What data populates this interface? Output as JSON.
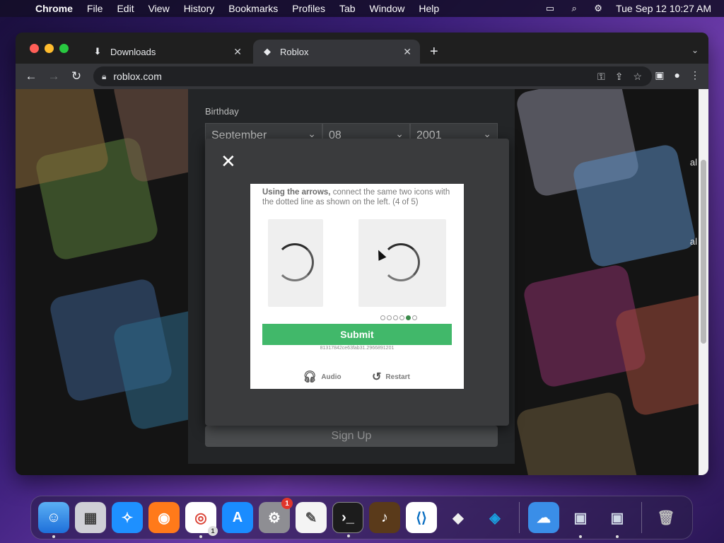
{
  "menubar": {
    "app": "Chrome",
    "items": [
      "File",
      "Edit",
      "View",
      "History",
      "Bookmarks",
      "Profiles",
      "Tab",
      "Window",
      "Help"
    ],
    "datetime": "Tue Sep 12  10:27 AM"
  },
  "browser": {
    "tabs": [
      {
        "title": "Downloads",
        "icon": "download-icon",
        "active": false
      },
      {
        "title": "Roblox",
        "icon": "roblox-icon",
        "active": true
      }
    ],
    "url": "roblox.com"
  },
  "page": {
    "birthday_label": "Birthday",
    "birthday": {
      "month": "September",
      "day": "08",
      "year": "2001"
    },
    "signup_label": "Sign Up",
    "side_text": [
      "al",
      "al"
    ]
  },
  "captcha": {
    "instruction_bold": "Using the arrows,",
    "instruction_rest": " connect the same two icons with the dotted line as shown on the left. (4 of 5)",
    "progress": {
      "current": 4,
      "total": 6
    },
    "submit_label": "Submit",
    "session_id": "81317842ce63fab31.2966891201",
    "audio_label": "Audio",
    "restart_label": "Restart"
  },
  "dock": {
    "apps": [
      "Finder",
      "Launchpad",
      "Safari",
      "Firefox",
      "Chrome",
      "App Store",
      "System Settings",
      "TextEdit",
      "Terminal",
      "GarageBand",
      "VS Code",
      "Roblox",
      "Roblox Studio",
      "Weather",
      "VirtualBox",
      "VirtualBox VM",
      "Trash"
    ],
    "badges": {
      "system_settings": "1",
      "chrome": "1"
    }
  }
}
